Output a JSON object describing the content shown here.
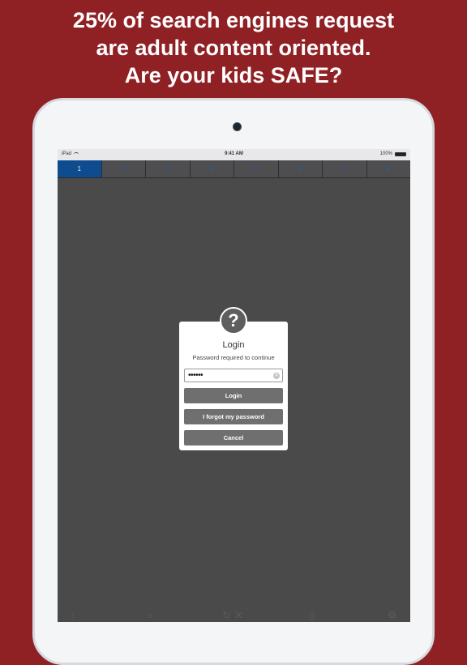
{
  "headline": {
    "line1": "25% of search engines request",
    "line2": "are adult content oriented.",
    "line3": "Are your kids SAFE?"
  },
  "statusbar": {
    "device": "iPad",
    "time": "9:41 AM",
    "battery": "100%"
  },
  "tabs": [
    {
      "label": "1",
      "active": true
    },
    {
      "label": "2",
      "active": false
    },
    {
      "label": "3",
      "active": false
    },
    {
      "label": "4",
      "active": false
    },
    {
      "label": "5",
      "active": false
    },
    {
      "label": "6",
      "active": false
    },
    {
      "label": "7",
      "active": false
    },
    {
      "label": "8",
      "active": false
    }
  ],
  "dialog": {
    "icon": "question-icon",
    "icon_glyph": "?",
    "title": "Login",
    "subtitle": "Password required to continue",
    "password_value": "••••••",
    "login_label": "Login",
    "forgot_label": "I forgot my password",
    "cancel_label": "Cancel"
  },
  "toolbar": {
    "icons": [
      "back-arrow-icon",
      "forward-arrow-icon",
      "reload-icon",
      "stop-icon",
      "bookmarks-icon",
      "settings-gear-icon"
    ]
  },
  "colors": {
    "background": "#8f2125",
    "active_tab": "#0f4c8f",
    "screen": "#4a4a4a",
    "dialog_button": "#6f6f6f"
  }
}
